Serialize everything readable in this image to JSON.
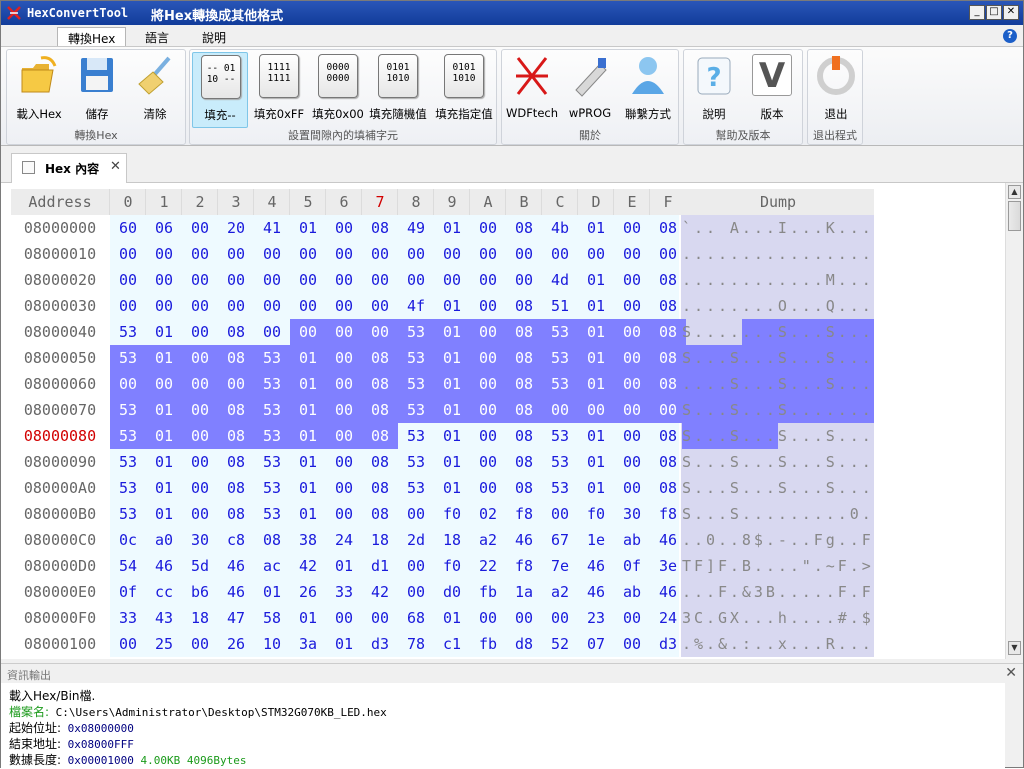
{
  "window": {
    "app_name": "HexConvertTool",
    "caption": "將Hex轉換成其他格式",
    "minimize": "_",
    "restore": "□",
    "close": "✕"
  },
  "ribbon_tabs": [
    "轉換Hex",
    "語言",
    "說明"
  ],
  "help_icon": "?",
  "ribbon": {
    "groups": [
      {
        "name": "轉換Hex",
        "buttons": [
          {
            "label": "載入Hex",
            "icon": "folder-open-icon"
          },
          {
            "label": "儲存",
            "icon": "floppy-disk-icon"
          },
          {
            "label": "清除",
            "icon": "broom-icon"
          }
        ]
      },
      {
        "name": "設置間隙內的填補字元",
        "buttons": [
          {
            "label": "填充--",
            "icon": "fill-dash-icon",
            "box": [
              "-- 01",
              "10 --"
            ]
          },
          {
            "label": "填充0xFF",
            "icon": "fill-ff-icon",
            "box": [
              "1111",
              "1111"
            ]
          },
          {
            "label": "填充0x00",
            "icon": "fill-00-icon",
            "box": [
              "0000",
              "0000"
            ]
          },
          {
            "label": "填充隨機值",
            "icon": "fill-random-icon",
            "box": [
              "0101",
              "1010"
            ]
          },
          {
            "label": "填充指定值",
            "icon": "fill-value-icon",
            "box": [
              "0101",
              "1010"
            ]
          }
        ]
      },
      {
        "name": "關於",
        "buttons": [
          {
            "label": "WDFtech",
            "icon": "wdftech-logo-icon"
          },
          {
            "label": "wPROG",
            "icon": "programmer-icon"
          },
          {
            "label": "聯繫方式",
            "icon": "contact-person-icon"
          }
        ]
      },
      {
        "name": "幫助及版本",
        "buttons": [
          {
            "label": "說明",
            "icon": "help-icon"
          },
          {
            "label": "版本",
            "icon": "version-icon",
            "glyph": "V"
          }
        ]
      },
      {
        "name": "退出程式",
        "buttons": [
          {
            "label": "退出",
            "icon": "power-icon"
          }
        ]
      }
    ]
  },
  "doc_tab": {
    "label": "Hex 內容",
    "close": "✕"
  },
  "hex_view": {
    "address_header": "Address",
    "columns": [
      "0",
      "1",
      "2",
      "3",
      "4",
      "5",
      "6",
      "7",
      "8",
      "9",
      "A",
      "B",
      "C",
      "D",
      "E",
      "F"
    ],
    "highlight_column": "7",
    "dump_header": "Dump",
    "rows": [
      {
        "addr": "08000000",
        "bytes": [
          "60",
          "06",
          "00",
          "20",
          "41",
          "01",
          "00",
          "08",
          "49",
          "01",
          "00",
          "08",
          "4b",
          "01",
          "00",
          "08"
        ],
        "dump": "`.. A...I...K...",
        "sel_from": -1,
        "sel_to": -1
      },
      {
        "addr": "08000010",
        "bytes": [
          "00",
          "00",
          "00",
          "00",
          "00",
          "00",
          "00",
          "00",
          "00",
          "00",
          "00",
          "00",
          "00",
          "00",
          "00",
          "00"
        ],
        "dump": "................",
        "sel_from": -1,
        "sel_to": -1
      },
      {
        "addr": "08000020",
        "bytes": [
          "00",
          "00",
          "00",
          "00",
          "00",
          "00",
          "00",
          "00",
          "00",
          "00",
          "00",
          "00",
          "4d",
          "01",
          "00",
          "08"
        ],
        "dump": "............M...",
        "sel_from": -1,
        "sel_to": -1
      },
      {
        "addr": "08000030",
        "bytes": [
          "00",
          "00",
          "00",
          "00",
          "00",
          "00",
          "00",
          "00",
          "4f",
          "01",
          "00",
          "08",
          "51",
          "01",
          "00",
          "08"
        ],
        "dump": "........O...Q...",
        "sel_from": -1,
        "sel_to": -1
      },
      {
        "addr": "08000040",
        "bytes": [
          "53",
          "01",
          "00",
          "08",
          "00",
          "00",
          "00",
          "00",
          "53",
          "01",
          "00",
          "08",
          "53",
          "01",
          "00",
          "08"
        ],
        "dump": "S.......S...S...",
        "sel_from": 5,
        "sel_to": 15
      },
      {
        "addr": "08000050",
        "bytes": [
          "53",
          "01",
          "00",
          "08",
          "53",
          "01",
          "00",
          "08",
          "53",
          "01",
          "00",
          "08",
          "53",
          "01",
          "00",
          "08"
        ],
        "dump": "S...S...S...S...",
        "sel_from": 0,
        "sel_to": 15
      },
      {
        "addr": "08000060",
        "bytes": [
          "00",
          "00",
          "00",
          "00",
          "53",
          "01",
          "00",
          "08",
          "53",
          "01",
          "00",
          "08",
          "53",
          "01",
          "00",
          "08"
        ],
        "dump": "....S...S...S...",
        "sel_from": 0,
        "sel_to": 15
      },
      {
        "addr": "08000070",
        "bytes": [
          "53",
          "01",
          "00",
          "08",
          "53",
          "01",
          "00",
          "08",
          "53",
          "01",
          "00",
          "08",
          "00",
          "00",
          "00",
          "00"
        ],
        "dump": "S...S...S.......",
        "sel_from": 0,
        "sel_to": 15
      },
      {
        "addr": "08000080",
        "bytes": [
          "53",
          "01",
          "00",
          "08",
          "53",
          "01",
          "00",
          "08",
          "53",
          "01",
          "00",
          "08",
          "53",
          "01",
          "00",
          "08"
        ],
        "dump": "S...S...S...S...",
        "sel_from": 0,
        "sel_to": 7
      },
      {
        "addr": "08000090",
        "bytes": [
          "53",
          "01",
          "00",
          "08",
          "53",
          "01",
          "00",
          "08",
          "53",
          "01",
          "00",
          "08",
          "53",
          "01",
          "00",
          "08"
        ],
        "dump": "S...S...S...S...",
        "sel_from": -1,
        "sel_to": -1
      },
      {
        "addr": "080000A0",
        "bytes": [
          "53",
          "01",
          "00",
          "08",
          "53",
          "01",
          "00",
          "08",
          "53",
          "01",
          "00",
          "08",
          "53",
          "01",
          "00",
          "08"
        ],
        "dump": "S...S...S...S...",
        "sel_from": -1,
        "sel_to": -1
      },
      {
        "addr": "080000B0",
        "bytes": [
          "53",
          "01",
          "00",
          "08",
          "53",
          "01",
          "00",
          "08",
          "00",
          "f0",
          "02",
          "f8",
          "00",
          "f0",
          "30",
          "f8"
        ],
        "dump": "S...S.........0.",
        "sel_from": -1,
        "sel_to": -1
      },
      {
        "addr": "080000C0",
        "bytes": [
          "0c",
          "a0",
          "30",
          "c8",
          "08",
          "38",
          "24",
          "18",
          "2d",
          "18",
          "a2",
          "46",
          "67",
          "1e",
          "ab",
          "46"
        ],
        "dump": "..0..8$.-..Fg..F",
        "sel_from": -1,
        "sel_to": -1
      },
      {
        "addr": "080000D0",
        "bytes": [
          "54",
          "46",
          "5d",
          "46",
          "ac",
          "42",
          "01",
          "d1",
          "00",
          "f0",
          "22",
          "f8",
          "7e",
          "46",
          "0f",
          "3e"
        ],
        "dump": "TF]F.B....\".~F.>",
        "sel_from": -1,
        "sel_to": -1
      },
      {
        "addr": "080000E0",
        "bytes": [
          "0f",
          "cc",
          "b6",
          "46",
          "01",
          "26",
          "33",
          "42",
          "00",
          "d0",
          "fb",
          "1a",
          "a2",
          "46",
          "ab",
          "46"
        ],
        "dump": "...F.&3B.....F.F",
        "sel_from": -1,
        "sel_to": -1
      },
      {
        "addr": "080000F0",
        "bytes": [
          "33",
          "43",
          "18",
          "47",
          "58",
          "01",
          "00",
          "00",
          "68",
          "01",
          "00",
          "00",
          "00",
          "23",
          "00",
          "24"
        ],
        "dump": "3C.GX...h....#.$",
        "sel_from": -1,
        "sel_to": -1
      },
      {
        "addr": "08000100",
        "bytes": [
          "00",
          "25",
          "00",
          "26",
          "10",
          "3a",
          "01",
          "d3",
          "78",
          "c1",
          "fb",
          "d8",
          "52",
          "07",
          "00",
          "d3"
        ],
        "dump": ".%.&.:..x...R...",
        "sel_from": -1,
        "sel_to": -1
      }
    ],
    "highlight_addr": "08000080"
  },
  "output": {
    "title": "資訊輸出",
    "close": "✕",
    "lines": [
      {
        "label": "載入Hex/Bin檔.",
        "value": "",
        "extra": ""
      },
      {
        "label": "檔案名:",
        "value": "C:\\Users\\Administrator\\Desktop\\STM32G070KB_LED.hex",
        "extra": "",
        "label_color": "green"
      },
      {
        "label": "起始位址:",
        "value": "0x08000000",
        "extra": ""
      },
      {
        "label": "結束地址:",
        "value": "0x08000FFF",
        "extra": ""
      },
      {
        "label": "數據長度:",
        "value": "0x00001000",
        "extra": "4.00KB   4096Bytes"
      }
    ]
  }
}
